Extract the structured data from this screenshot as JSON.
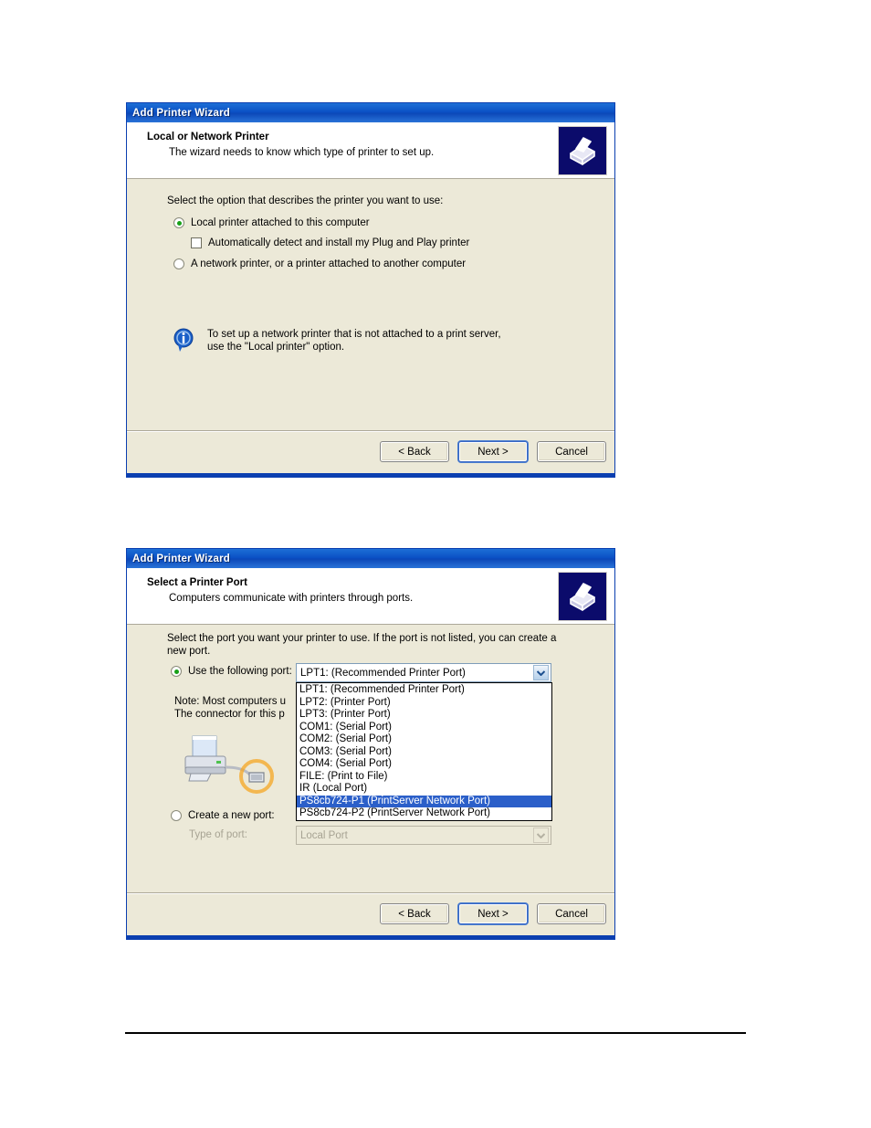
{
  "page": {
    "footer_rule": true
  },
  "dialog1": {
    "title": "Add Printer Wizard",
    "header_title": "Local or Network Printer",
    "header_subtitle": "The wizard needs to know which type of printer to set up.",
    "prompt": "Select the option that describes the printer you want to use:",
    "option_local": "Local printer attached to this computer",
    "option_autodetect": "Automatically detect and install my Plug and Play printer",
    "option_network": "A network printer, or a printer attached to another computer",
    "note_text": "To set up a network printer that is not attached to a print server,\nuse the \"Local printer\" option.",
    "icon_name": "printer-icon",
    "info_icon_name": "info-icon",
    "buttons": {
      "back": "< Back",
      "next": "Next >",
      "cancel": "Cancel"
    }
  },
  "dialog2": {
    "title": "Add Printer Wizard",
    "header_title": "Select a Printer Port",
    "header_subtitle": "Computers communicate with printers through ports.",
    "prompt_line1": "Select the port you want your printer to use.  If the port is not listed, you can create a",
    "prompt_line2": "new port.",
    "option_use_port": "Use the following port:",
    "note_line1": "Note: Most computers u",
    "note_line2": "The connector for this p",
    "option_create_port": "Create a new port:",
    "label_type_of_port": "Type of port:",
    "combo_selected": "LPT1: (Recommended Printer Port)",
    "type_of_port_value": "Local Port",
    "dropdown_items": [
      "LPT1: (Recommended Printer Port)",
      "LPT2: (Printer Port)",
      "LPT3: (Printer Port)",
      "COM1: (Serial Port)",
      "COM2: (Serial Port)",
      "COM3: (Serial Port)",
      "COM4: (Serial Port)",
      "FILE: (Print to File)",
      "IR (Local Port)",
      "PS8cb724-P1 (PrintServer Network Port)",
      "PS8cb724-P2 (PrintServer Network Port)"
    ],
    "dropdown_selected_index": 9,
    "icon_name": "printer-icon",
    "illustration_name": "printer-cable-illustration",
    "buttons": {
      "back": "< Back",
      "next": "Next >",
      "cancel": "Cancel"
    }
  },
  "colors": {
    "titlebar_blue": "#0b4fc4",
    "dialog_face": "#ece9d8",
    "selection_blue": "#2b5fc9",
    "border_blue": "#0b3fb0",
    "highlight_orange": "#f5a623"
  }
}
